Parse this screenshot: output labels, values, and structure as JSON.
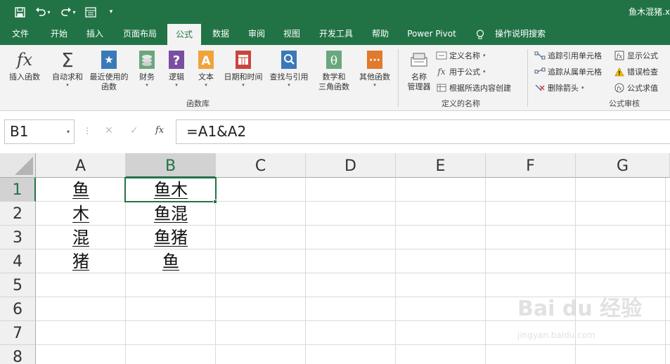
{
  "titlebar": {
    "document_title": "鱼木混猪.x",
    "qat": [
      "save-icon",
      "undo-icon",
      "redo-icon",
      "form-icon",
      "customize-icon"
    ]
  },
  "tabs": [
    {
      "label": "文件",
      "active": false
    },
    {
      "label": "开始",
      "active": false
    },
    {
      "label": "插入",
      "active": false
    },
    {
      "label": "页面布局",
      "active": false
    },
    {
      "label": "公式",
      "active": true
    },
    {
      "label": "数据",
      "active": false
    },
    {
      "label": "审阅",
      "active": false
    },
    {
      "label": "视图",
      "active": false
    },
    {
      "label": "开发工具",
      "active": false
    },
    {
      "label": "帮助",
      "active": false
    },
    {
      "label": "Power Pivot",
      "active": false
    }
  ],
  "tell_me": "操作说明搜索",
  "ribbon": {
    "function_library": {
      "label": "函数库",
      "insert_function": "插入函数",
      "autosum": "自动求和",
      "recent_l1": "最近使用的",
      "recent_l2": "函数",
      "financial": "财务",
      "logical": "逻辑",
      "text": "文本",
      "datetime": "日期和时间",
      "lookup": "查找与引用",
      "math_l1": "数学和",
      "math_l2": "三角函数",
      "more": "其他函数"
    },
    "defined_names": {
      "label": "定义的名称",
      "name_manager_l1": "名称",
      "name_manager_l2": "管理器",
      "define_name": "定义名称",
      "use_in_formula": "用于公式",
      "create_from_selection": "根据所选内容创建"
    },
    "formula_auditing": {
      "label": "公式审核",
      "trace_precedents": "追踪引用单元格",
      "trace_dependents": "追踪从属单元格",
      "remove_arrows": "删除箭头",
      "show_formulas": "显示公式",
      "error_checking": "错误检查",
      "evaluate_formula": "公式求值"
    }
  },
  "formula_bar": {
    "name_box": "B1",
    "formula": "=A1&A2",
    "fx": "fx"
  },
  "grid": {
    "columns": [
      "A",
      "B",
      "C",
      "D",
      "E",
      "F",
      "G"
    ],
    "rows": [
      "1",
      "2",
      "3",
      "4",
      "5",
      "6",
      "7",
      "8"
    ],
    "selected_cell": "B1",
    "cells": {
      "A1": "鱼",
      "A2": "木",
      "A3": "混",
      "A4": "猪",
      "B1": "鱼木",
      "B2": "鱼混",
      "B3": "鱼猪",
      "B4": "鱼"
    }
  },
  "watermark": {
    "logo": "Bai du 经验",
    "url": "jingyan.baidu.com"
  },
  "colors": {
    "accent": "#217346",
    "ribbon_bg": "#f3f3f3",
    "header_bg": "#f0f0f0",
    "selected_header_bg": "#d2d2d2"
  }
}
